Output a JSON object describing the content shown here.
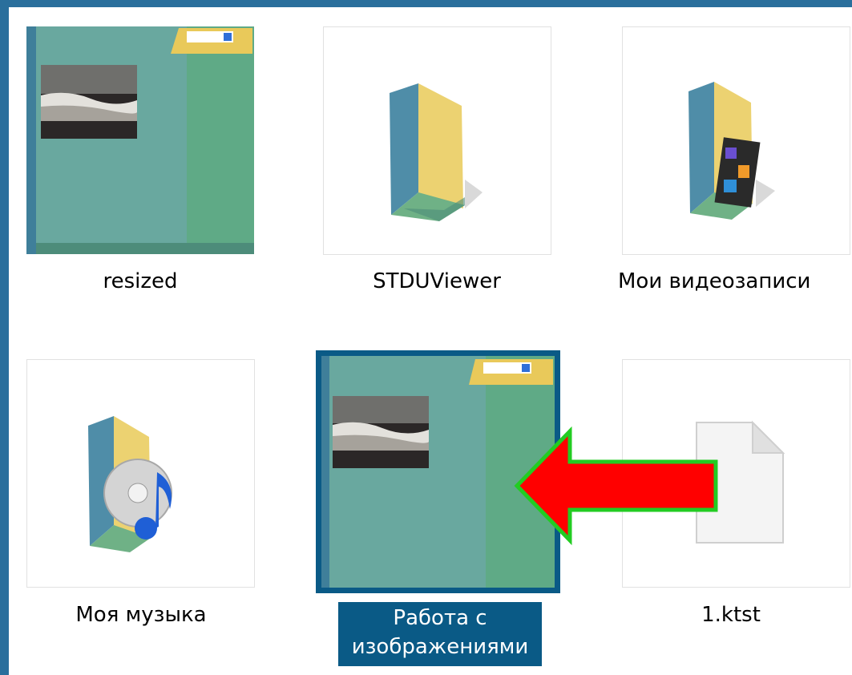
{
  "items": [
    {
      "label": "resized",
      "icon": "folder-preview-icon",
      "selected": false
    },
    {
      "label": "STDUViewer",
      "icon": "folder-icon",
      "selected": false
    },
    {
      "label": "Мои видеозаписи",
      "icon": "video-folder-icon",
      "selected": false
    },
    {
      "label": "Моя музыка",
      "icon": "music-folder-icon",
      "selected": false
    },
    {
      "label_line1": "Работа с",
      "label_line2": "изображениями",
      "icon": "folder-preview-icon",
      "selected": true
    },
    {
      "label": "1.ktst",
      "icon": "file-icon",
      "selected": false
    }
  ],
  "annotation": {
    "icon": "red-arrow-icon",
    "fill": "#ff0000",
    "outline": "#22cc22"
  },
  "colors": {
    "window_background": "#2a6f9c",
    "selection": "#0a5a86"
  }
}
